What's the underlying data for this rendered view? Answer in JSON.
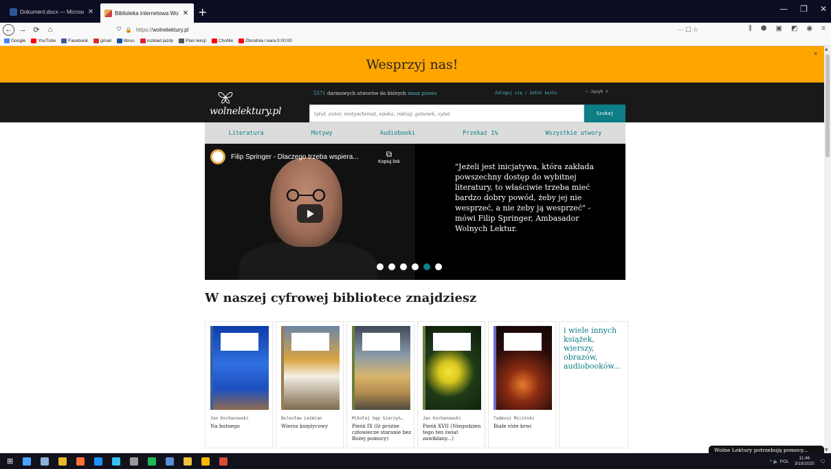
{
  "browser": {
    "tabs": [
      {
        "title": "Dokument.docx — Microsoft",
        "icon": "word-icon",
        "color": "#2b5797"
      },
      {
        "title": "Biblioteka internetowa Wolne L",
        "icon": "wolnelektury-icon",
        "color": "#e7a84c"
      }
    ],
    "new_tab": "+",
    "window_controls": [
      "—",
      "❐",
      "✕"
    ],
    "url_scheme": "https://",
    "url_host": "wolnelektury.pl",
    "url_actions": "··· ☐ ☆",
    "bookmarks": [
      {
        "label": "Google",
        "color": "#4285f4"
      },
      {
        "label": "YouTube",
        "color": "#ff0000"
      },
      {
        "label": "Facebook",
        "color": "#3b5998"
      },
      {
        "label": "gmail",
        "color": "#d93025"
      },
      {
        "label": "librus",
        "color": "#1b4ea0"
      },
      {
        "label": "rozkład jazdy",
        "color": "#d23"
      },
      {
        "label": "Plan lekcji",
        "color": "#555"
      },
      {
        "label": "ChoMe",
        "color": "#ff0000"
      },
      {
        "label": "Zbrodnia i kara 0:00:00",
        "color": "#ff0000"
      }
    ]
  },
  "page": {
    "support_banner": "Wesprzyj nas!",
    "support_close": "x",
    "logo_text": "wolnelektury.pl",
    "tagline_count": "5571",
    "tagline_mid": " darmowych utworów do których ",
    "tagline_link": "masz prawo",
    "login": "Zaloguj się / Załóż konto",
    "language": "⚐ Język ▽",
    "search_placeholder": "tytuł, autor, motyw/temat, epoka, rodzaj, gatunek, cytat",
    "search_button": "Szukaj",
    "menu": [
      "Literatura",
      "Motywy",
      "Audiobooki",
      "Przekaż 1%",
      "Wszystkie utwory"
    ],
    "video_title": "Filip Springer - Dlaczego trzeba wspiera...",
    "video_copy": "Kopiuj link",
    "quote": "\"Jeżeli jest inicjatywa, która zakłada powszechny dostęp do wybitnej literatury, to właściwie trzeba mieć bardzo dobry powód, żeby jej nie wesprzeć, a nie żeby ją wesprzeć\" - mówi Filip Springer, Ambasador Wolnych Lektur.",
    "carousel_active_index": 4,
    "carousel_count": 6,
    "section_heading": "W naszej cyfrowej bibliotece znajdziesz",
    "books": [
      {
        "author": "Jan Kochanowski",
        "title": "Na butnego",
        "cover_bg": "linear-gradient(180deg,#0d3ea8 0%,#2f6fe0 45%,#1e4fbf 75%,#8f6b4f 100%)",
        "strip": "#3a5fa0"
      },
      {
        "author": "Bolesław Leśmian",
        "title": "Wiersz księżycowy",
        "cover_bg": "linear-gradient(180deg,#6a86a8 0%,#d9a441 40%,#f2efe4 60%,#7d6a4c 100%)",
        "strip": "#9a7b52"
      },
      {
        "author": "Mikołaj Sęp Szarzyń…",
        "title": "Pieśń IX (Iż próżne człowiecze staranie bez Bożej pomocy)",
        "cover_bg": "linear-gradient(180deg,#3f4a57 0%,#8a9aa8 35%,#d7b56a 60%,#b28a4f 80%,#4f4a3f 100%)",
        "strip": "#6e7f3f"
      },
      {
        "author": "Jan Kochanowski",
        "title": "Pieśń XVII (Niegodzien tego ten świat zawikłany...)",
        "cover_bg": "radial-gradient(circle at 45% 55%,#f2e53a 0%,#d8c81e 18%,#1f3b16 45%,#0e1c0b 100%)",
        "strip": "#6e7f3f"
      },
      {
        "author": "Tadeusz Miciński",
        "title": "Białe róże krwi",
        "cover_bg": "radial-gradient(circle at 50% 70%,#e87a2a 0%,#8a2b12 25%,#2a0c0a 60%,#120606 100%)",
        "strip": "#6a6acf"
      }
    ],
    "more_text": "i wiele innych książek, wierszy, obrazów, audiobooków..."
  },
  "taskbar": {
    "icons": [
      "#4aa3ff",
      "#8fb0d8",
      "#e8b62c",
      "#ff7139",
      "#1e90ff",
      "#35c0f0",
      "#999",
      "#1db954",
      "#5a8fd6",
      "#f0c23a",
      "#f7b500",
      "#d94b3a"
    ],
    "tray": "^ 🔈 POL",
    "time": "11:46",
    "date": "3/19/2020",
    "notification": "Wolne Lektury potrzebują pomocy..."
  }
}
